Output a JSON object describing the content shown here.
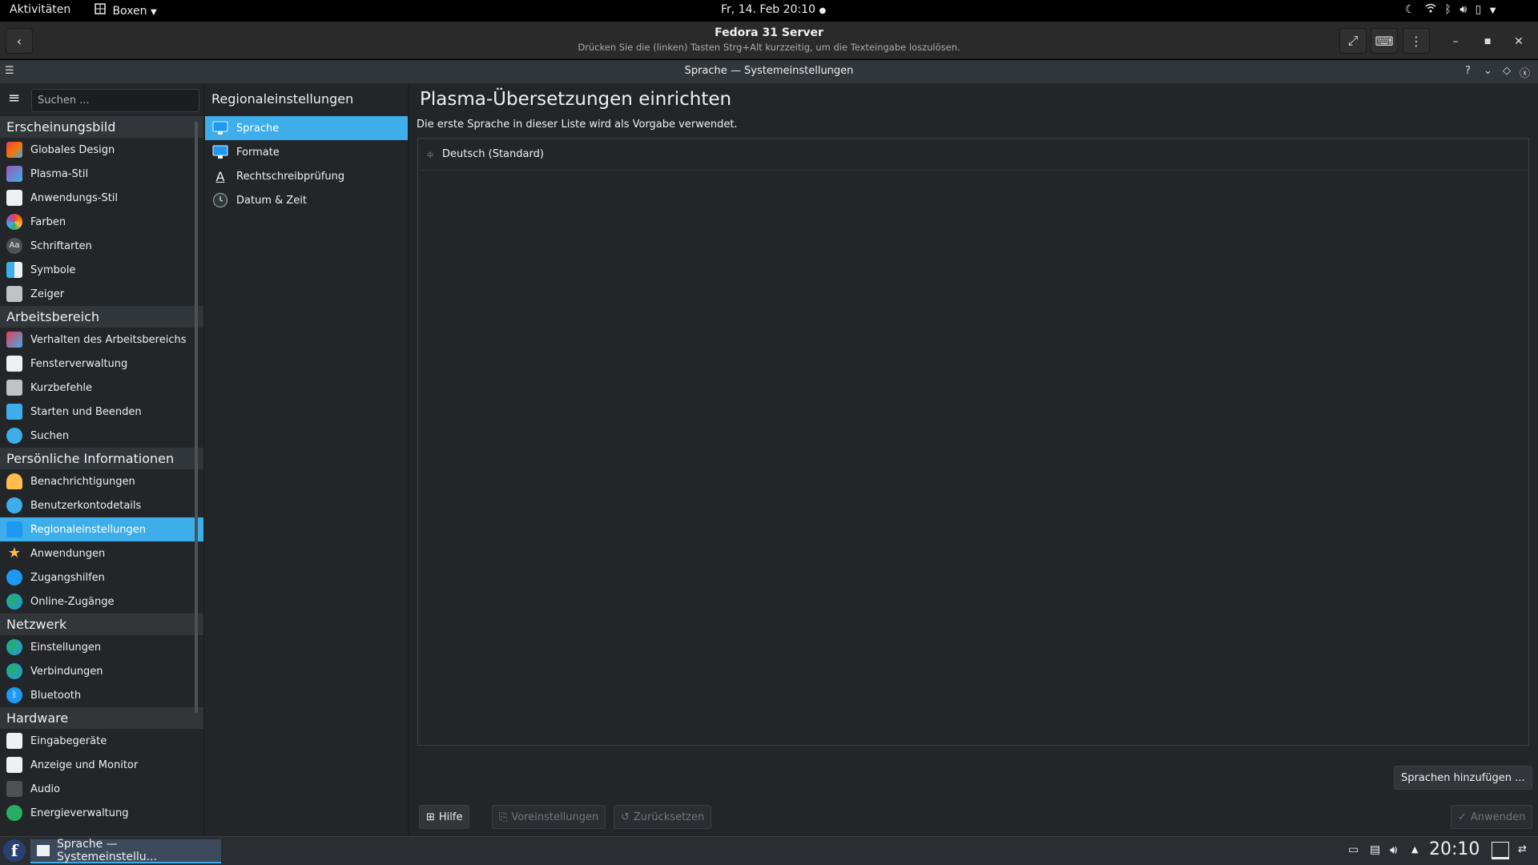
{
  "gnome_bar": {
    "activities": "Aktivitäten",
    "app_menu": "Boxen",
    "datetime": "Fr, 14. Feb  20:10"
  },
  "boxes_header": {
    "title": "Fedora 31 Server",
    "subtitle": "Drücken Sie die (linken) Tasten Strg+Alt kurzzeitig, um die Texteingabe loszulösen."
  },
  "window": {
    "title": "Sprache — Systemeinstellungen"
  },
  "search": {
    "placeholder": "Suchen ..."
  },
  "sidebar": {
    "categories": [
      {
        "label": "Erscheinungsbild",
        "items": [
          {
            "label": "Globales Design"
          },
          {
            "label": "Plasma-Stil"
          },
          {
            "label": "Anwendungs-Stil"
          },
          {
            "label": "Farben"
          },
          {
            "label": "Schriftarten"
          },
          {
            "label": "Symbole"
          },
          {
            "label": "Zeiger"
          }
        ]
      },
      {
        "label": "Arbeitsbereich",
        "items": [
          {
            "label": "Verhalten des Arbeitsbereichs"
          },
          {
            "label": "Fensterverwaltung"
          },
          {
            "label": "Kurzbefehle"
          },
          {
            "label": "Starten und Beenden"
          },
          {
            "label": "Suchen"
          }
        ]
      },
      {
        "label": "Persönliche Informationen",
        "items": [
          {
            "label": "Benachrichtigungen"
          },
          {
            "label": "Benutzerkontodetails"
          },
          {
            "label": "Regionaleinstellungen"
          },
          {
            "label": "Anwendungen"
          },
          {
            "label": "Zugangshilfen"
          },
          {
            "label": "Online-Zugänge"
          }
        ]
      },
      {
        "label": "Netzwerk",
        "items": [
          {
            "label": "Einstellungen"
          },
          {
            "label": "Verbindungen"
          },
          {
            "label": "Bluetooth"
          }
        ]
      },
      {
        "label": "Hardware",
        "items": [
          {
            "label": "Eingabegeräte"
          },
          {
            "label": "Anzeige und Monitor"
          },
          {
            "label": "Audio"
          },
          {
            "label": "Energieverwaltung"
          }
        ]
      }
    ]
  },
  "middle": {
    "title": "Regionaleinstellungen",
    "items": [
      {
        "label": "Sprache"
      },
      {
        "label": "Formate"
      },
      {
        "label": "Rechtschreibprüfung"
      },
      {
        "label": "Datum & Zeit"
      }
    ]
  },
  "content": {
    "title": "Plasma-Übersetzungen einrichten",
    "description": "Die erste Sprache in dieser Liste wird als Vorgabe verwendet.",
    "languages": [
      "Deutsch (Standard)"
    ],
    "add_button": "Sprachen hinzufügen ...",
    "help_button": "Hilfe",
    "defaults_button": "Voreinstellungen",
    "reset_button": "Zurücksetzen",
    "apply_button": "Anwenden"
  },
  "taskbar": {
    "task_label": "Sprache  — Systemeinstellu...",
    "clock": "20:10"
  },
  "colors": {
    "accent": "#3daee9",
    "background": "#232629",
    "header": "#31363b"
  }
}
